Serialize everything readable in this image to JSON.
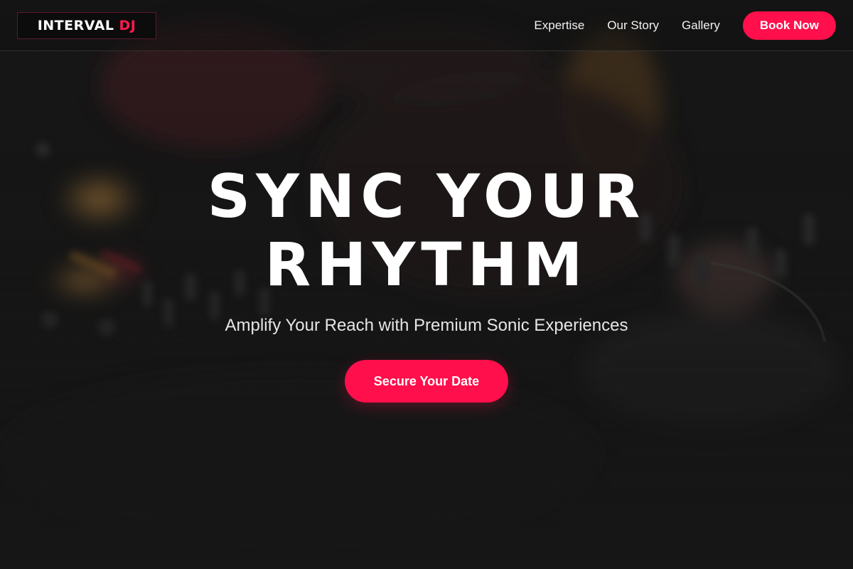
{
  "header": {
    "logo_main": "INTERVAL",
    "logo_accent": "DJ",
    "nav": [
      {
        "label": "Expertise"
      },
      {
        "label": "Our Story"
      },
      {
        "label": "Gallery"
      }
    ],
    "cta_label": "Book Now"
  },
  "hero": {
    "title_line1": "SYNC YOUR",
    "title_line2": "RHYTHM",
    "subtitle": "Amplify Your Reach with Premium Sonic Experiences",
    "cta_label": "Secure Your Date",
    "background": "blurred-dj-mixer-photo"
  },
  "colors": {
    "accent": "#ff0f4b",
    "background": "#141414",
    "text": "#ffffff"
  }
}
